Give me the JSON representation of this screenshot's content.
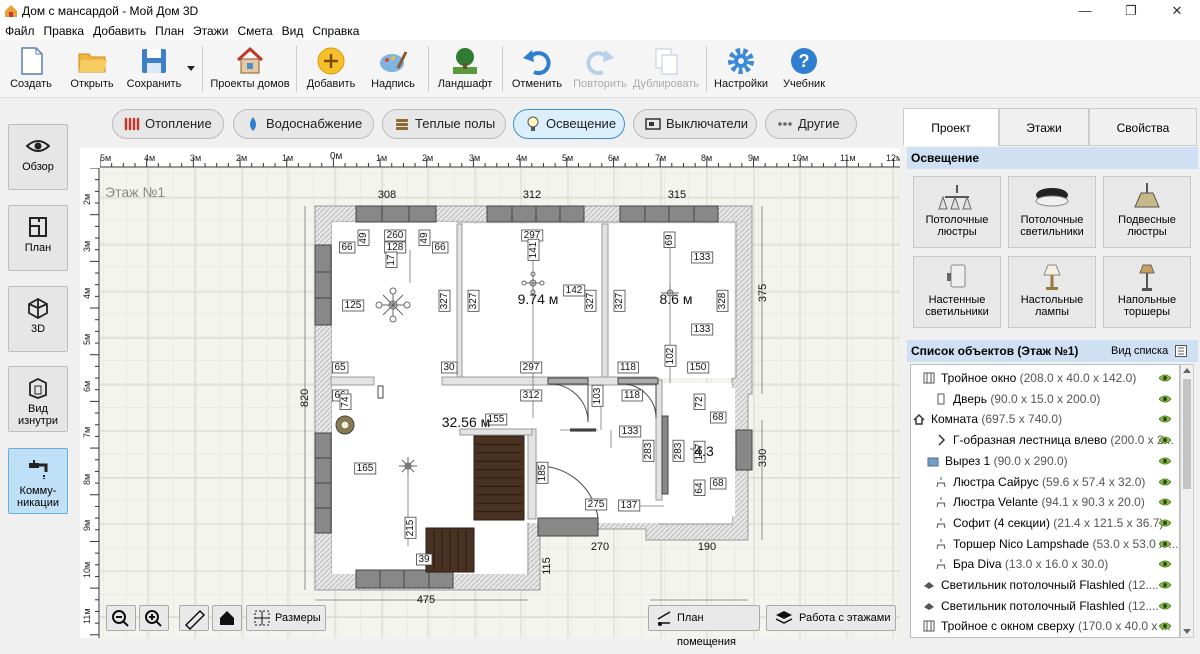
{
  "window": {
    "title": "Дом с мансардой - Мой Дом 3D",
    "min_glyph": "—",
    "max_glyph": "❐",
    "close_glyph": "✕"
  },
  "menu": [
    "Файл",
    "Правка",
    "Добавить",
    "План",
    "Этажи",
    "Смета",
    "Вид",
    "Справка"
  ],
  "toolbar": {
    "create": "Создать",
    "open": "Открыть",
    "save": "Сохранить",
    "projects": "Проекты домов",
    "add": "Добавить",
    "caption": "Надпись",
    "landscape": "Ландшафт",
    "undo": "Отменить",
    "redo": "Повторить",
    "duplicate": "Дублировать",
    "settings": "Настройки",
    "tutorial": "Учебник"
  },
  "leftbar": {
    "overview": "Обзор",
    "plan": "План",
    "3d": "3D",
    "inside1": "Вид",
    "inside2": "изнутри",
    "comm1": "Комму-",
    "comm2": "никации"
  },
  "filters": {
    "heating": "Отопление",
    "water": "Водоснабжение",
    "floor": "Теплые полы",
    "lighting": "Освещение",
    "switches": "Выключатели",
    "other": "Другие"
  },
  "plan": {
    "floor_label": "Этаж №1",
    "ruler_top": [
      "5м",
      "4м",
      "3м",
      "2м",
      "1м",
      "0м",
      "1м",
      "2м",
      "3м",
      "4м",
      "5м",
      "6м",
      "7м",
      "8м",
      "9м",
      "10м",
      "11м",
      "12м"
    ],
    "ruler_left": [
      "2м",
      "3м",
      "4м",
      "5м",
      "6м",
      "7м",
      "8м",
      "9м",
      "10м",
      "11м"
    ],
    "dims": {
      "d308": "308",
      "d312a": "312",
      "d315": "315",
      "d375": "375",
      "d820": "820",
      "d475": "475",
      "d270": "270",
      "d190": "190",
      "d330": "330",
      "d260": "260",
      "d297a": "297",
      "d66a": "66",
      "d49a": "49",
      "d128": "128",
      "d49b": "49",
      "d66b": "66",
      "d125": "125",
      "d327a": "327",
      "d327b": "327",
      "d327c": "327",
      "d327d": "327",
      "d328": "328",
      "d142": "142",
      "d141": "141",
      "d133a": "133",
      "d133b": "133",
      "d69": "69",
      "d102": "102",
      "d65": "65",
      "d30": "30",
      "d297b": "297",
      "d118a": "118",
      "d150": "150",
      "d66c": "66",
      "d74": "74",
      "d155": "155",
      "d312b": "312",
      "d103": "103",
      "d118b": "118",
      "d133c": "133",
      "d72": "72",
      "d68a": "68",
      "d137": "137",
      "d68b": "68",
      "d64": "64",
      "d283a": "283",
      "d283b": "283",
      "d165": "165",
      "d215": "215",
      "d185": "185",
      "d275": "275",
      "d137b": "137",
      "d115": "115",
      "d39": "39",
      "d17": "17"
    },
    "area_a": "9.74 м",
    "area_b": "8.6 м",
    "area_c": "32.56 м",
    "area_d": "4.3"
  },
  "bottombar": {
    "sizes": "Размеры",
    "room_plan": "План помещения",
    "floors_work": "Работа с этажами"
  },
  "rightpanel": {
    "tabs": {
      "project": "Проект",
      "floors": "Этажи",
      "props": "Свойства"
    },
    "lighting_hdr": "Освещение",
    "cats": [
      [
        "Потолочные",
        "люстры"
      ],
      [
        "Потолочные",
        "светильники"
      ],
      [
        "Подвесные",
        "люстры"
      ],
      [
        "Настенные",
        "светильники"
      ],
      [
        "Настольные",
        "лампы"
      ],
      [
        "Напольные",
        "торшеры"
      ]
    ],
    "objlist_hdr": "Список объектов (Этаж №1)",
    "view_list": "Вид списка",
    "objects": [
      {
        "name": "Тройное окно",
        "vals": "(208.0 x 40.0 x 142.0)"
      },
      {
        "name": "Дверь",
        "vals": "(90.0 x 15.0 x 200.0)"
      },
      {
        "name": "Комната",
        "vals": "(697.5 x 740.0)"
      },
      {
        "name": "Г-образная лестница влево",
        "vals": "(200.0 x 2..."
      },
      {
        "name": "Вырез 1",
        "vals": "(90.0 x 290.0)"
      },
      {
        "name": "Люстра Сайрус",
        "vals": "(59.6 x 57.4 x 32.0)"
      },
      {
        "name": "Люстра Velante",
        "vals": "(94.1 x 90.3 x 20.0)"
      },
      {
        "name": "Софит (4 секции)",
        "vals": "(21.4 x 121.5 x 36.7)"
      },
      {
        "name": "Торшер Nico Lampshade",
        "vals": "(53.0 x 53.0 x ..."
      },
      {
        "name": "Бра Diva",
        "vals": "(13.0 x 16.0 x 30.0)"
      },
      {
        "name": "Светильник потолочный Flashled",
        "vals": "(12...."
      },
      {
        "name": "Светильник потолочный Flashled",
        "vals": "(12...."
      },
      {
        "name": "Тройное с окном сверху",
        "vals": "(170.0 x 40.0 x ..."
      }
    ]
  }
}
